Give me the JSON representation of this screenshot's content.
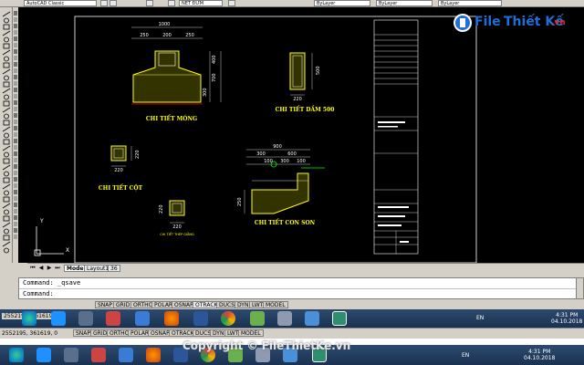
{
  "toolbar": {
    "workspace": "AutoCAD Classic",
    "text_style": "NET ĐỨM",
    "layer_color": "ByLayer",
    "layer_linetype": "ByLayer",
    "layer_lineweight": "ByLayer"
  },
  "watermark": {
    "logo_file": "File",
    "logo_rest": "Thiết Kế",
    "logo_tld": ".vn",
    "copyright": "Copyright © FileThietKe.vn"
  },
  "drawing": {
    "mong_title": "CHI TIẾT MÓNG",
    "mong_dims_top": "1000",
    "mong_dims_sub": [
      "250",
      "200",
      "250"
    ],
    "mong_dims_side": [
      "700",
      "300",
      "400"
    ],
    "dam_title": "CHI TIẾT DẦM 500",
    "dam_dim_w": "220",
    "dam_dim_h": "500",
    "cot_title": "CHI TIẾT CỘT",
    "cot_dim_w": "220",
    "cot_dim_h": "220",
    "conson_title": "CHI TIẾT CON SON",
    "conson_dims_top": "900",
    "conson_dims_sub": [
      "300",
      "600"
    ],
    "conson_dims_sub2": [
      "100",
      "300",
      "100"
    ],
    "conson_dim_h": "250",
    "small_title": "CHI TIẾT THÉP GIẰNG",
    "small_dim_w": "220",
    "small_dim_h": "220",
    "ucs_x": "X",
    "ucs_y": "Y"
  },
  "layout_tabs": [
    {
      "label": "Model"
    },
    {
      "label": "Layout1"
    },
    {
      "label": "36"
    }
  ],
  "command": {
    "line1": "Command: _qsave",
    "line2": "Command:"
  },
  "status": {
    "buttons": [
      "SNAP",
      "GRID",
      "ORTHO",
      "POLAR",
      "OSNAP",
      "OTRACK",
      "DUCS",
      "DYN",
      "LWT",
      "MODEL"
    ]
  },
  "taskbar1": {
    "coords": "2552195, 361619, 0",
    "lang": "EN",
    "time": "4:31 PM",
    "date": "04.10.2018"
  },
  "taskbar2": {
    "coords": "2552195, 361619, 0",
    "status_buttons": [
      "SNAP",
      "GRID",
      "ORTHO",
      "POLAR",
      "OSNAP",
      "OTRACK",
      "DUCS",
      "DYN",
      "LWT",
      "MODEL"
    ],
    "lang": "EN",
    "time": "4:31 PM",
    "date": "04.10.2018"
  },
  "colors": {
    "canvas": "#000000",
    "cad_white": "#ffffff",
    "cad_yellow": "#ffff00",
    "cad_green": "#00ff00",
    "cad_red": "#ff0000",
    "logo_blue": "#1e6fd9",
    "logo_red": "#e22b2b"
  }
}
